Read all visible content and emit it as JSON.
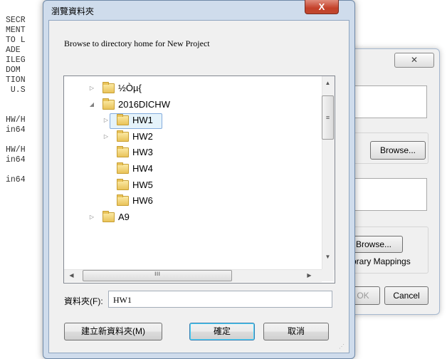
{
  "terminal_lines": [
    "SECR",
    "MENT",
    "TO L",
    "ADE",
    "ILEG",
    "DOM",
    "TION",
    " U.S",
    "",
    "",
    "HW/H",
    "in64",
    "",
    "HW/H",
    "in64",
    "",
    "in64"
  ],
  "back_dialog": {
    "close_glyph": "✕",
    "browse_label_1": "Browse...",
    "browse_label_2": "Browse...",
    "mappings_label": "brary Mappings",
    "ok_label": "OK",
    "cancel_label": "Cancel"
  },
  "dialog": {
    "title": "瀏覽資料夾",
    "close_glyph": "X",
    "instruction": "Browse to directory home for New Project",
    "tree": [
      {
        "label": "½Òµ{",
        "expander": "▷",
        "level": 0
      },
      {
        "label": "2016DICHW",
        "expander": "◢",
        "level": 0
      },
      {
        "label": "HW1",
        "expander": "▷",
        "level": 1,
        "selected": true
      },
      {
        "label": "HW2",
        "expander": "▷",
        "level": 1
      },
      {
        "label": "HW3",
        "expander": "",
        "level": 1
      },
      {
        "label": "HW4",
        "expander": "",
        "level": 1
      },
      {
        "label": "HW5",
        "expander": "",
        "level": 1
      },
      {
        "label": "HW6",
        "expander": "",
        "level": 1
      },
      {
        "label": "A9",
        "expander": "▷",
        "level": 0
      }
    ],
    "folder_label": "資料夾(F):",
    "folder_value": "HW1",
    "new_folder_button": "建立新資料夾(M)",
    "ok_button": "確定",
    "cancel_button": "取消"
  }
}
